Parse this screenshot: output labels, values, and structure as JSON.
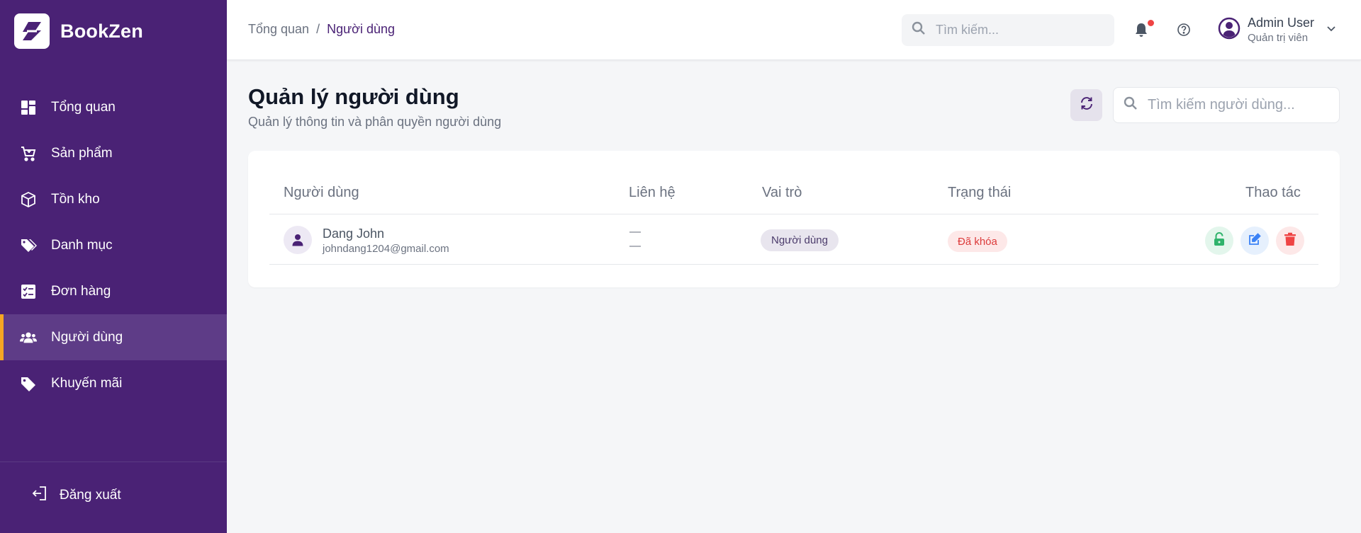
{
  "brand": {
    "name": "BookZen"
  },
  "sidebar": {
    "items": [
      {
        "label": "Tổng quan",
        "icon": "dashboard-icon"
      },
      {
        "label": "Sản phẩm",
        "icon": "cart-icon"
      },
      {
        "label": "Tồn kho",
        "icon": "box-icon"
      },
      {
        "label": "Danh mục",
        "icon": "tags-icon"
      },
      {
        "label": "Đơn hàng",
        "icon": "checklist-icon"
      },
      {
        "label": "Người dùng",
        "icon": "users-icon",
        "active": true
      },
      {
        "label": "Khuyến mãi",
        "icon": "tag-icon"
      }
    ],
    "logout_label": "Đăng xuất"
  },
  "header": {
    "breadcrumb": [
      "Tổng quan",
      "Người dùng"
    ],
    "breadcrumb_separator": "/",
    "search_placeholder": "Tìm kiếm...",
    "user": {
      "name": "Admin User",
      "role": "Quản trị viên"
    }
  },
  "main": {
    "title": "Quản lý người dùng",
    "subtitle": "Quản lý thông tin và phân quyền người dùng",
    "search_placeholder": "Tìm kiếm người dùng..."
  },
  "table": {
    "columns": [
      "Người dùng",
      "Liên hệ",
      "Vai trò",
      "Trạng thái",
      "Thao tác"
    ],
    "rows": [
      {
        "name": "Dang John",
        "email": "johndang1204@gmail.com",
        "contact_line1": "—",
        "contact_line2": "—",
        "role": "Người dùng",
        "status": "Đã khóa"
      }
    ]
  },
  "colors": {
    "sidebar_bg": "#4a2275",
    "active_accent": "#f5a623",
    "locked_status": "#dc3b3b",
    "unlock_action": "#2fb36b",
    "edit_action": "#3b82f6",
    "delete_action": "#ef4444"
  }
}
